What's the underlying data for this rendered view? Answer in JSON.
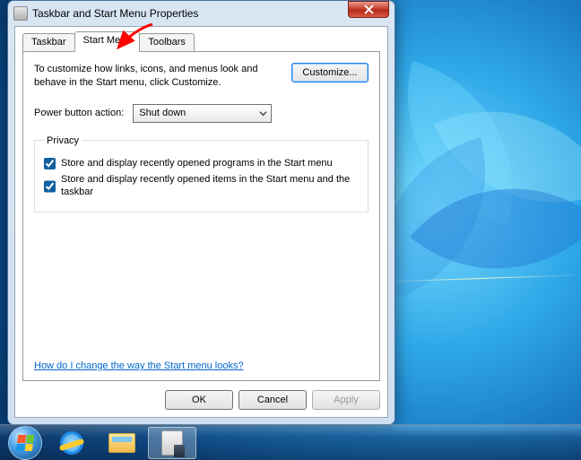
{
  "window": {
    "title": "Taskbar and Start Menu Properties",
    "tabs": [
      {
        "label": "Taskbar",
        "active": false
      },
      {
        "label": "Start Menu",
        "active": true
      },
      {
        "label": "Toolbars",
        "active": false
      }
    ],
    "intro": "To customize how links, icons, and menus look and behave in the Start menu, click Customize.",
    "customize_label": "Customize...",
    "power_label": "Power button action:",
    "power_value": "Shut down",
    "privacy_legend": "Privacy",
    "privacy_opt1": "Store and display recently opened programs in the Start menu",
    "privacy_opt1_checked": true,
    "privacy_opt2": "Store and display recently opened items in the Start menu and the taskbar",
    "privacy_opt2_checked": true,
    "help_link": "How do I change the way the Start menu looks?",
    "buttons": {
      "ok": "OK",
      "cancel": "Cancel",
      "apply": "Apply"
    }
  },
  "taskbar": {
    "items": [
      {
        "name": "start",
        "active": false
      },
      {
        "name": "ie",
        "active": false
      },
      {
        "name": "explorer",
        "active": false
      },
      {
        "name": "properties",
        "active": true
      }
    ]
  },
  "annotation": {
    "arrow_color": "#ff0000"
  }
}
